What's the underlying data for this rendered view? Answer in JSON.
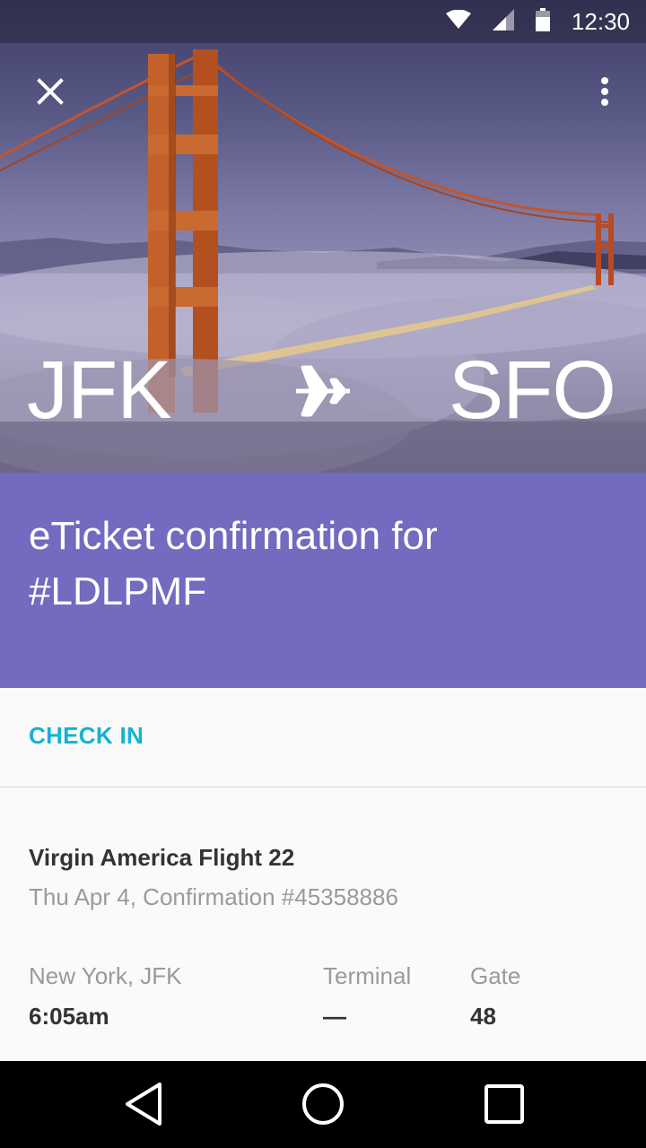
{
  "status_bar": {
    "time": "12:30",
    "icons": [
      "wifi-icon",
      "cell-signal-icon",
      "battery-icon"
    ]
  },
  "header": {
    "close_icon": "close-icon",
    "menu_icon": "more-vert-icon"
  },
  "route": {
    "from": "JFK",
    "to": "SFO",
    "icon": "airplane-icon"
  },
  "title_band": {
    "title": "eTicket confirmation for #LDLPMF",
    "color": "#726bc0"
  },
  "actions": {
    "check_in": "CHECK IN",
    "accent": "#13b3d0"
  },
  "flight": {
    "name": "Virgin America Flight 22",
    "subtitle": "Thu Apr 4, Confirmation #45358886",
    "departure": {
      "origin_label": "New York, JFK",
      "time": "6:05am",
      "terminal_label": "Terminal",
      "terminal_value": "—",
      "gate_label": "Gate",
      "gate_value": "48"
    }
  },
  "nav_bar": {
    "icons": [
      "back-icon",
      "home-icon",
      "recents-icon"
    ]
  }
}
